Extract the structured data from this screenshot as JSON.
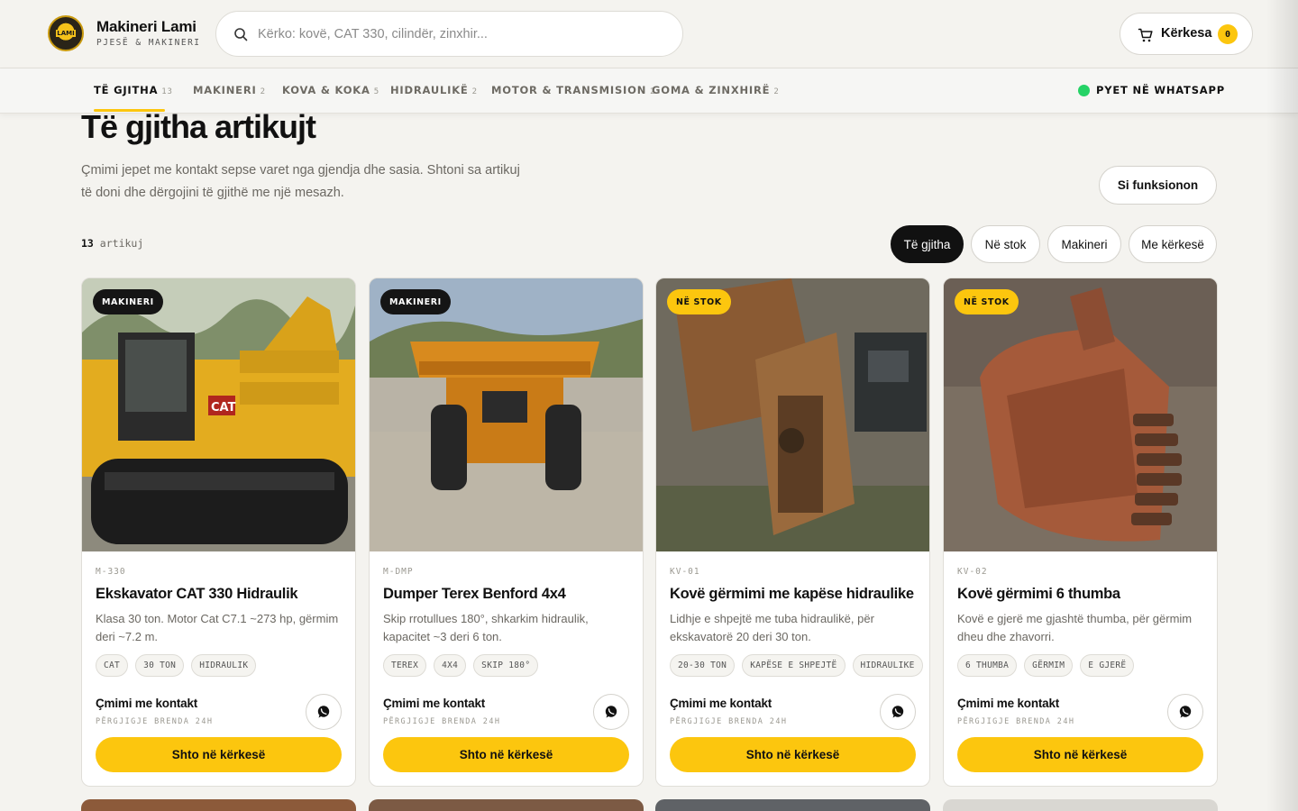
{
  "brand": {
    "name": "Makineri Lami",
    "tagline": "PJESË & MAKINERI",
    "logo_text": "LAMI"
  },
  "search": {
    "placeholder": "Kërko: kovë, CAT 330, cilindër, zinxhir..."
  },
  "cart": {
    "label": "Kërkesa",
    "count": "0"
  },
  "nav": {
    "items": [
      {
        "label": "TË GJITHA",
        "count": "13"
      },
      {
        "label": "MAKINERI",
        "count": "2"
      },
      {
        "label": "KOVA & KOKA",
        "count": "5"
      },
      {
        "label": "HIDRAULIKË",
        "count": "2"
      },
      {
        "label": "MOTOR & TRANSMISION",
        "count": "2"
      },
      {
        "label": "GOMA & ZINXHIRË",
        "count": "2"
      }
    ],
    "whatsapp": "PYET NË WHATSAPP"
  },
  "page": {
    "title": "Të gjitha artikujt",
    "description": "Çmimi jepet me kontakt sepse varet nga gjendja dhe sasia. Shtoni sa artikuj të doni dhe dërgojini të gjithë me një mesazh.",
    "how_button": "Si funksionon",
    "count_num": "13",
    "count_label": "artikuj"
  },
  "filters": [
    "Të gjitha",
    "Në stok",
    "Makineri",
    "Me kërkesë"
  ],
  "products": [
    {
      "badge": "MAKINERI",
      "sku": "M-330",
      "title": "Ekskavator CAT 330 Hidraulik",
      "description": "Klasa 30 ton. Motor Cat C7.1 ~273 hp, gërmim deri ~7.2 m.",
      "chips": [
        "CAT",
        "30 TON",
        "HIDRAULIK"
      ],
      "price": "Çmimi me kontakt",
      "response": "PËRGJIGJE BRENDA 24H",
      "add": "Shto në kërkesë"
    },
    {
      "badge": "MAKINERI",
      "sku": "M-DMP",
      "title": "Dumper Terex Benford 4x4",
      "description": "Skip rrotullues 180°, shkarkim hidraulik, kapacitet ~3 deri 6 ton.",
      "chips": [
        "TEREX",
        "4X4",
        "SKIP 180°"
      ],
      "price": "Çmimi me kontakt",
      "response": "PËRGJIGJE BRENDA 24H",
      "add": "Shto në kërkesë"
    },
    {
      "badge": "NË STOK",
      "sku": "KV-01",
      "title": "Kovë gërmimi me kapëse hidraulike",
      "description": "Lidhje e shpejtë me tuba hidraulikë, për ekskavatorë 20 deri 30 ton.",
      "chips": [
        "20-30 TON",
        "KAPËSE E SHPEJTË",
        "HIDRAULIKE"
      ],
      "price": "Çmimi me kontakt",
      "response": "PËRGJIGJE BRENDA 24H",
      "add": "Shto në kërkesë"
    },
    {
      "badge": "NË STOK",
      "sku": "KV-02",
      "title": "Kovë gërmimi 6 thumba",
      "description": "Kovë e gjerë me gjashtë thumba, për gërmim dheu dhe zhavorri.",
      "chips": [
        "6 THUMBA",
        "GËRMIM",
        "E GJERË"
      ],
      "price": "Çmimi me kontakt",
      "response": "PËRGJIGJE BRENDA 24H",
      "add": "Shto në kërkesë"
    }
  ],
  "colors": {
    "accent": "#fcc60e",
    "dark": "#111111",
    "background": "#f4f3ef",
    "whatsapp": "#25d366"
  },
  "icons": {
    "search": "search-icon",
    "cart": "cart-icon",
    "whatsapp": "whatsapp-icon"
  }
}
